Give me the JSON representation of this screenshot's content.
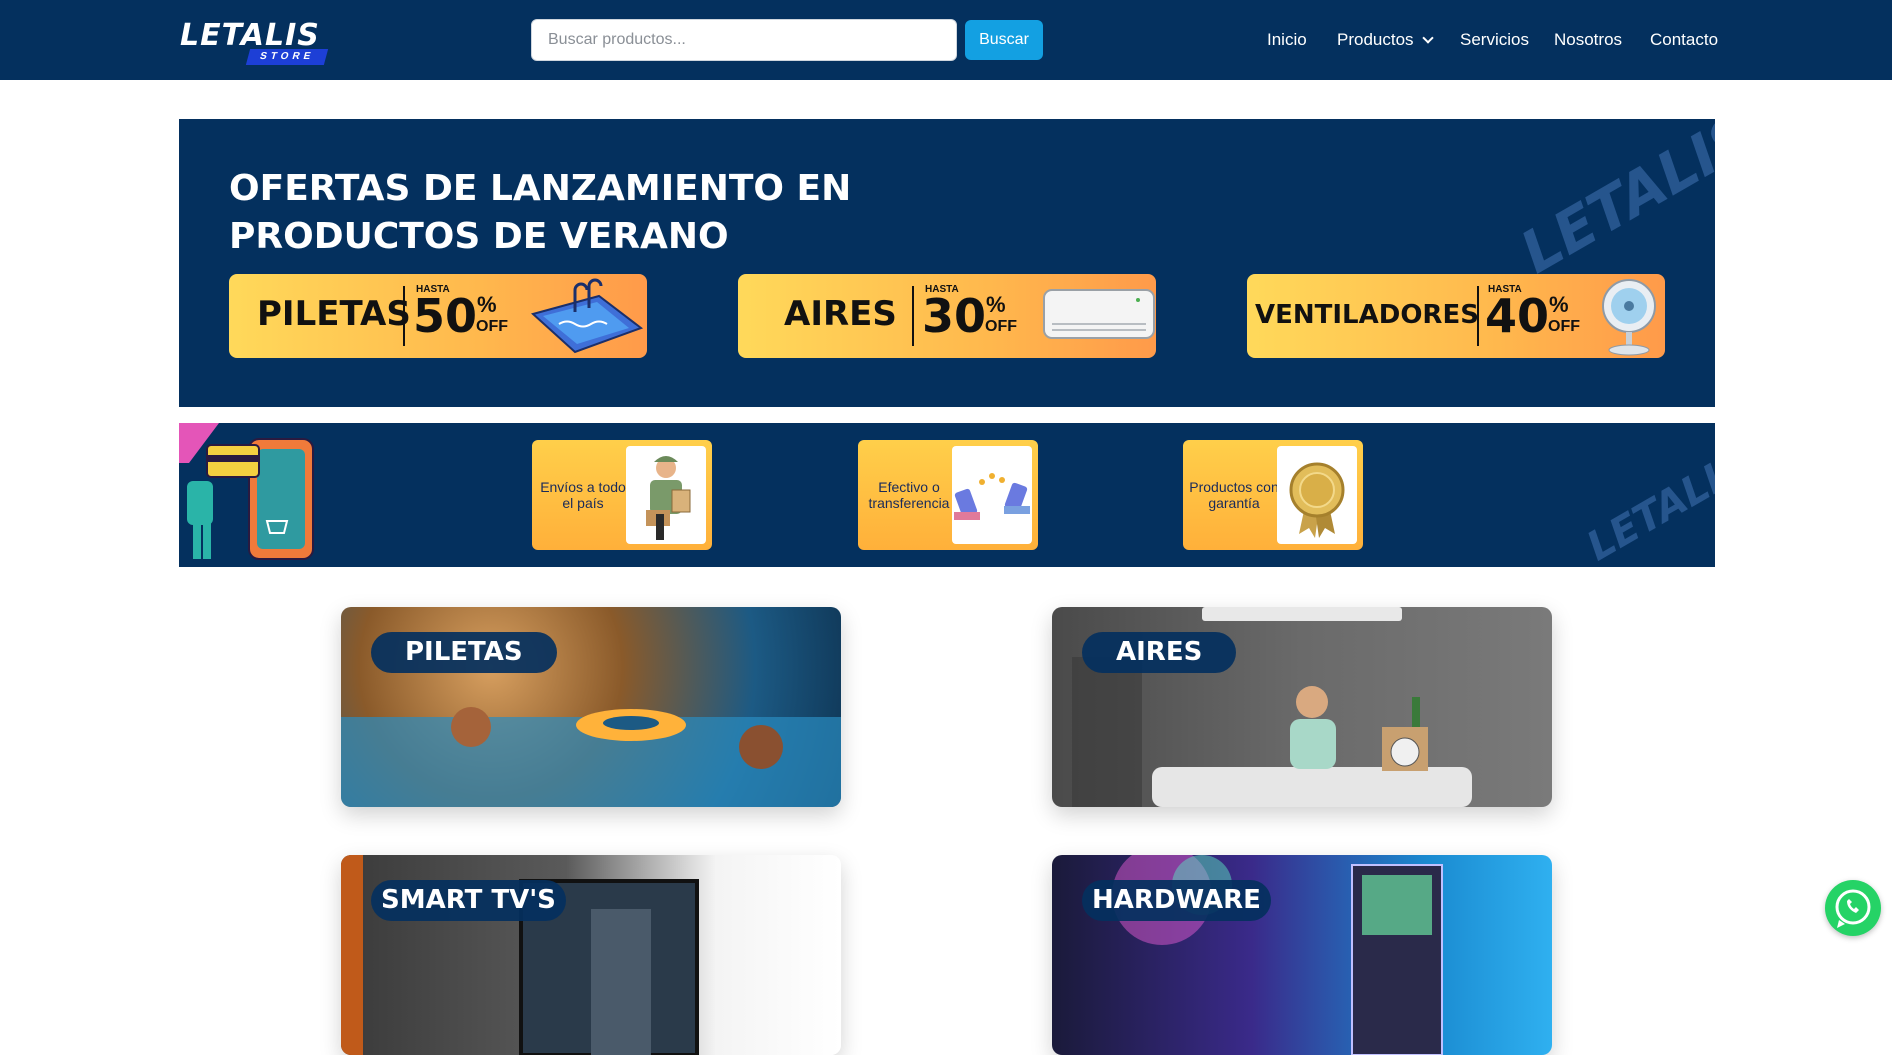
{
  "header": {
    "logo_text": "LETALIS",
    "logo_sub": "STORE",
    "search_placeholder": "Buscar productos...",
    "search_button": "Buscar",
    "nav": [
      "Inicio",
      "Productos",
      "Servicios",
      "Nosotros",
      "Contacto"
    ]
  },
  "hero": {
    "title": "OFERTAS DE LANZAMIENTO EN PRODUCTOS DE VERANO",
    "promos": [
      {
        "name": "PILETAS",
        "hasta": "HASTA",
        "percent": "50",
        "pct_sign": "%",
        "off": "OFF",
        "icon": "pool-icon"
      },
      {
        "name": "AIRES",
        "hasta": "HASTA",
        "percent": "30",
        "pct_sign": "%",
        "off": "OFF",
        "icon": "air-conditioner-icon"
      },
      {
        "name": "VENTILADORES",
        "hasta": "HASTA",
        "percent": "40",
        "pct_sign": "%",
        "off": "OFF",
        "icon": "fan-icon"
      }
    ]
  },
  "features": {
    "items": [
      {
        "label": "Envíos a todo el país",
        "icon": "delivery-person-icon"
      },
      {
        "label": "Efectivo o transferencia",
        "icon": "phone-transfer-icon"
      },
      {
        "label": "Productos con garantía",
        "icon": "warranty-badge-icon"
      }
    ]
  },
  "categories": [
    {
      "label": "PILETAS"
    },
    {
      "label": "AIRES"
    },
    {
      "label": "SMART TV'S"
    },
    {
      "label": "HARDWARE"
    }
  ],
  "colors": {
    "navy": "#04305e",
    "accent_blue": "#13a0e2",
    "promo_yellow": "#ffd95a",
    "promo_orange": "#ff9a4a",
    "whatsapp_green": "#25d366"
  }
}
